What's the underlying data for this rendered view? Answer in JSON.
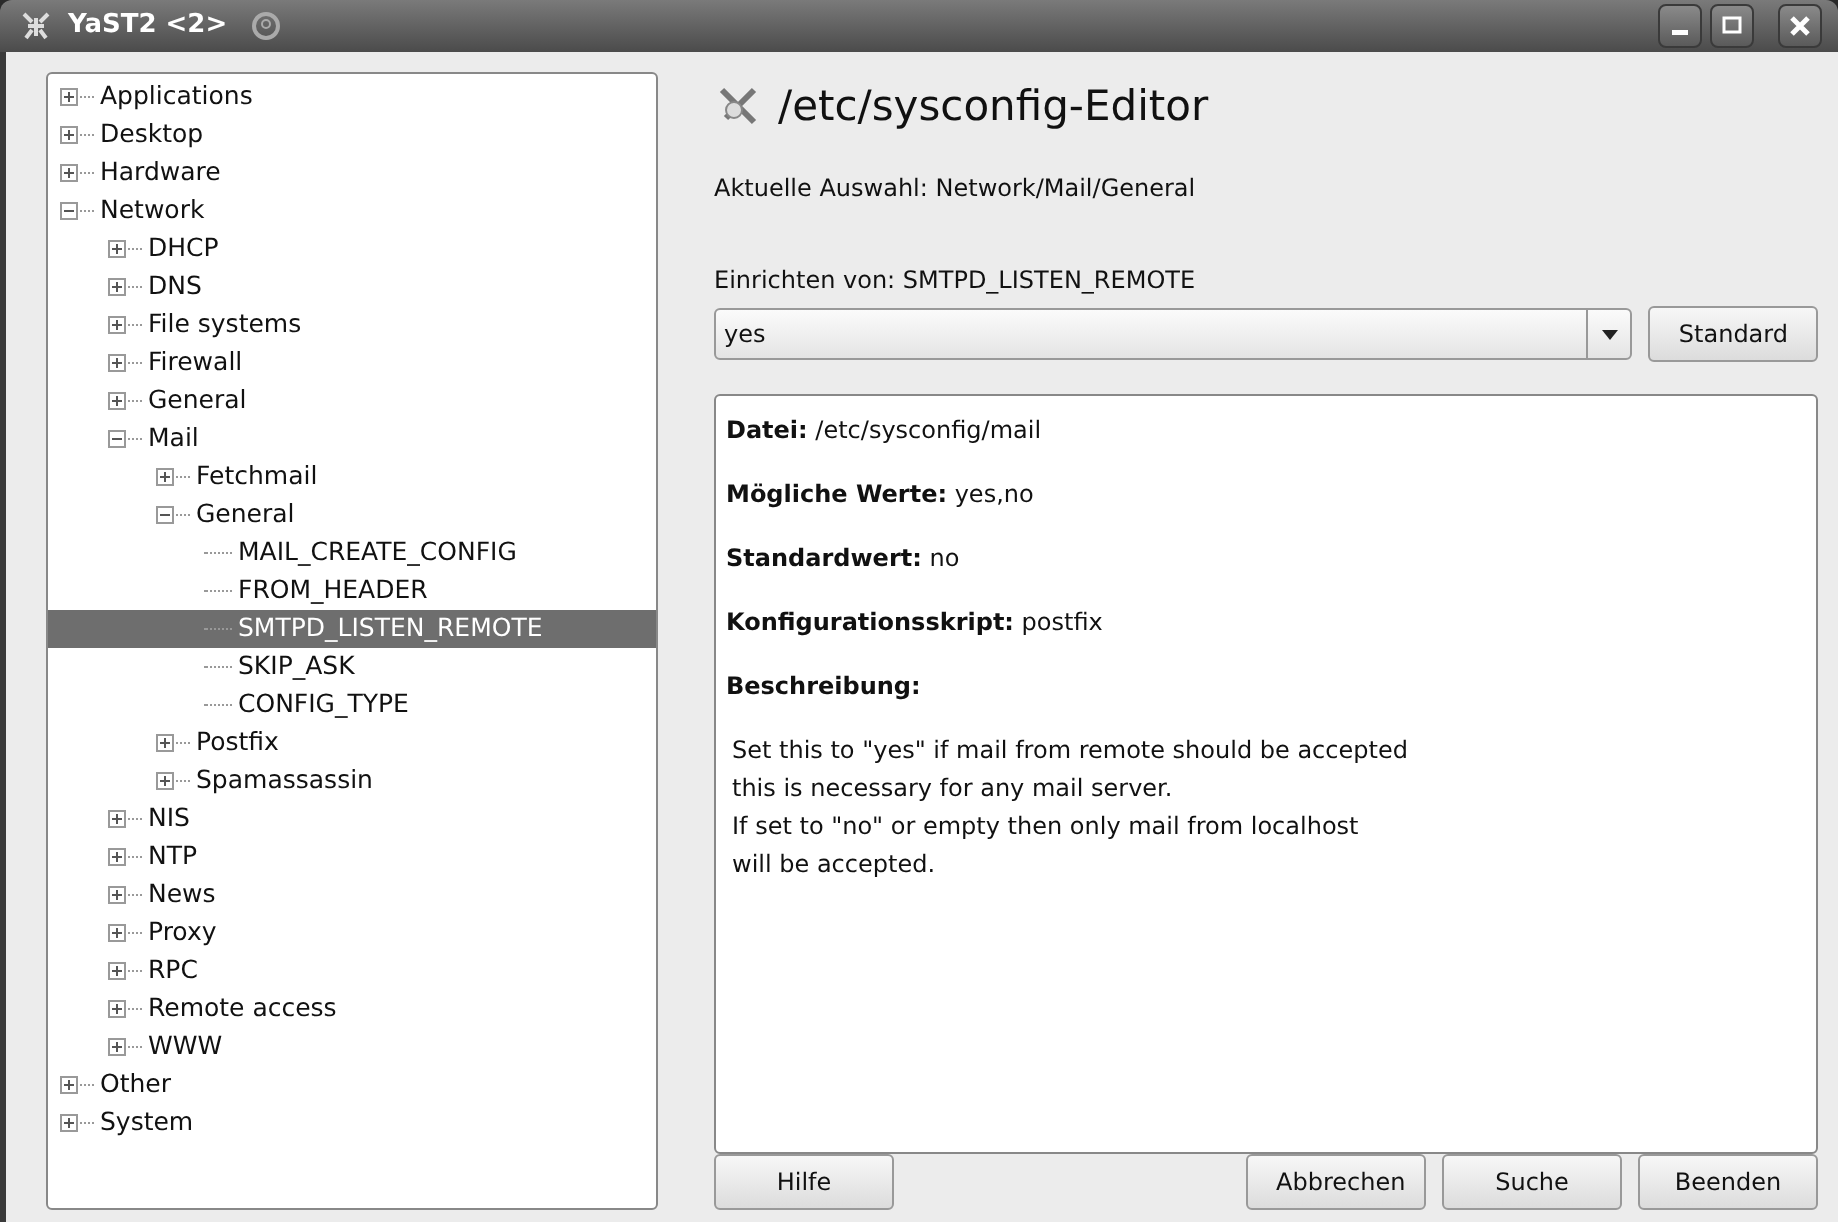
{
  "window": {
    "title": "YaST2 <2>"
  },
  "tree": [
    {
      "label": "Applications",
      "expanded": false,
      "selected": false
    },
    {
      "label": "Desktop",
      "expanded": false,
      "selected": false
    },
    {
      "label": "Hardware",
      "expanded": false,
      "selected": false
    },
    {
      "label": "Network",
      "expanded": true,
      "selected": false,
      "children": [
        {
          "label": "DHCP",
          "expanded": false,
          "selected": false
        },
        {
          "label": "DNS",
          "expanded": false,
          "selected": false
        },
        {
          "label": "File systems",
          "expanded": false,
          "selected": false
        },
        {
          "label": "Firewall",
          "expanded": false,
          "selected": false
        },
        {
          "label": "General",
          "expanded": false,
          "selected": false
        },
        {
          "label": "Mail",
          "expanded": true,
          "selected": false,
          "children": [
            {
              "label": "Fetchmail",
              "expanded": false,
              "selected": false
            },
            {
              "label": "General",
              "expanded": true,
              "selected": false,
              "children": [
                {
                  "label": "MAIL_CREATE_CONFIG",
                  "kind": "leaf",
                  "selected": false
                },
                {
                  "label": "FROM_HEADER",
                  "kind": "leaf",
                  "selected": false
                },
                {
                  "label": "SMTPD_LISTEN_REMOTE",
                  "kind": "leaf",
                  "selected": true
                },
                {
                  "label": "SKIP_ASK",
                  "kind": "leaf",
                  "selected": false
                },
                {
                  "label": "CONFIG_TYPE",
                  "kind": "leaf",
                  "selected": false
                }
              ]
            },
            {
              "label": "Postfix",
              "expanded": false,
              "selected": false
            },
            {
              "label": "Spamassassin",
              "expanded": false,
              "selected": false
            }
          ]
        },
        {
          "label": "NIS",
          "expanded": false,
          "selected": false
        },
        {
          "label": "NTP",
          "expanded": false,
          "selected": false
        },
        {
          "label": "News",
          "expanded": false,
          "selected": false
        },
        {
          "label": "Proxy",
          "expanded": false,
          "selected": false
        },
        {
          "label": "RPC",
          "expanded": false,
          "selected": false
        },
        {
          "label": "Remote access",
          "expanded": false,
          "selected": false
        },
        {
          "label": "WWW",
          "expanded": false,
          "selected": false
        }
      ]
    },
    {
      "label": "Other",
      "expanded": false,
      "selected": false
    },
    {
      "label": "System",
      "expanded": false,
      "selected": false
    }
  ],
  "heading": "/etc/sysconfig-Editor",
  "current_selection": "Aktuelle Auswahl: Network/Mail/General",
  "setting_label": "Einrichten von: SMTPD_LISTEN_REMOTE",
  "setting_value": "yes",
  "default_button": "Standard",
  "info": [
    "**Datei:** /etc/sysconfig/mail",
    "**Mögliche Werte:** yes,no",
    "**Standardwert:** no",
    "**Konfigurationsskript:** postfix",
    "**Beschreibung:**"
  ],
  "description": [
    "Set this to \"yes\" if mail from remote should be accepted",
    "this is necessary for any mail server.",
    "If set to \"no\" or empty then only mail from localhost",
    "will be accepted."
  ],
  "buttons": [
    "Hilfe",
    "Abbrechen",
    "Suche",
    "Beenden"
  ]
}
